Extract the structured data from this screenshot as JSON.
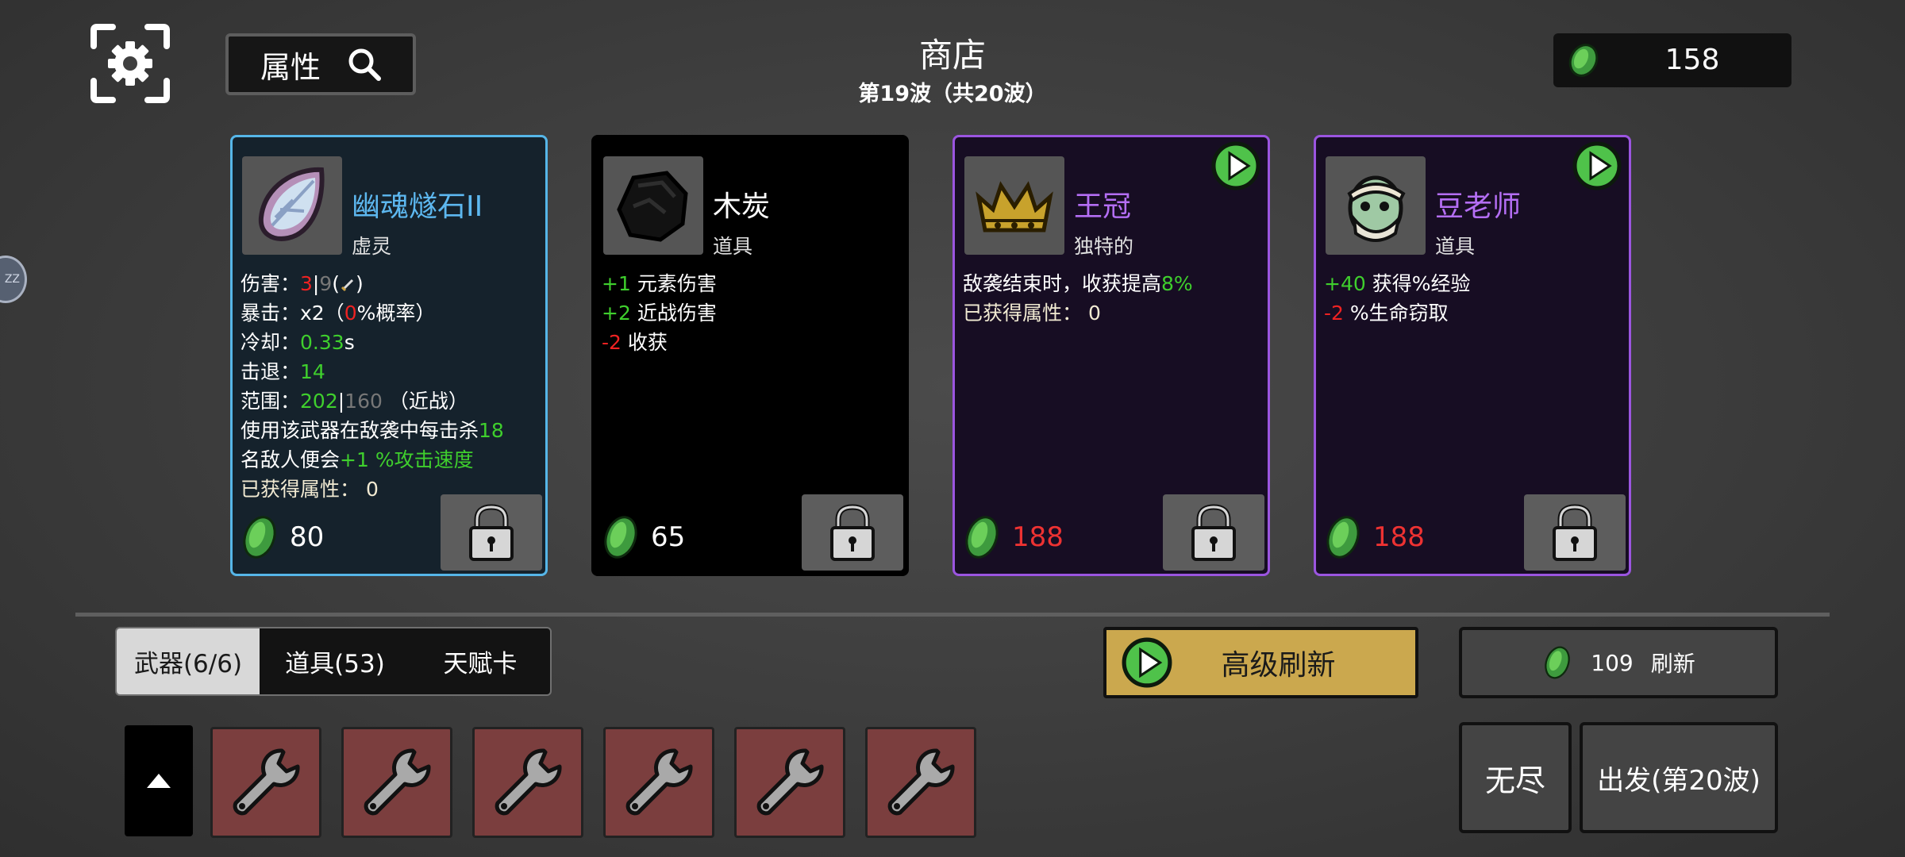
{
  "header": {
    "attributes_label": "属性",
    "title": "商店",
    "wave_subtitle": "第19波（共20波）",
    "money": "158"
  },
  "side_bubble": "ZZ",
  "cards": [
    {
      "name": "幽魂燧石II",
      "type": "虚灵",
      "price": "80",
      "stats": {
        "damage_label": "伤害：",
        "damage_value": "3",
        "damage_base": "9",
        "crit_label": "暴击：",
        "crit_mult": "x2（",
        "crit_chance": "0",
        "crit_suffix": "%概率）",
        "cooldown_label": "冷却：",
        "cooldown_value": "0.33",
        "cooldown_unit": "s",
        "knockback_label": "击退：",
        "knockback_value": "14",
        "range_label": "范围：",
        "range_value": "202",
        "range_base": "160",
        "range_suffix": "（近战）",
        "effect_text_1": "使用该武器在敌袭中每击杀",
        "effect_kills": "18",
        "effect_text_2": "名敌人便会",
        "effect_bonus": "+1 %攻击速度",
        "acquired_label": "已获得属性：",
        "acquired_value": "0"
      }
    },
    {
      "name": "木炭",
      "type": "道具",
      "price": "65",
      "stats": [
        {
          "value": "+1",
          "text": "元素伤害",
          "color": "#3fcf2d"
        },
        {
          "value": "+2",
          "text": "近战伤害",
          "color": "#3fcf2d"
        },
        {
          "value": "-2",
          "text": "收获",
          "color": "#ee2222"
        }
      ]
    },
    {
      "name": "王冠",
      "type": "独特的",
      "price": "188",
      "stats": {
        "line1_text": "敌袭结束时，收获提高",
        "line1_value": "8%",
        "line2_label": "已获得属性：",
        "line2_value": "0"
      }
    },
    {
      "name": "豆老师",
      "type": "道具",
      "price": "188",
      "stats": [
        {
          "value": "+40",
          "text": "获得%经验",
          "color": "#3fcf2d"
        },
        {
          "value": "-2",
          "text": "%生命窃取",
          "color": "#ee2222"
        }
      ]
    }
  ],
  "tabs": [
    "武器(6/6)",
    "道具(53)",
    "天赋卡"
  ],
  "advanced_refresh_label": "高级刷新",
  "refresh": {
    "cost": "109",
    "label": "刷新"
  },
  "weapon_slots": 6,
  "endless_label": "无尽",
  "depart_label": "出发(第20波)",
  "colors": {
    "money_green": "#4caf50",
    "positive": "#3fcf2d",
    "negative": "#ee2222",
    "rare_border": "#56b6e8",
    "epic_border": "#9b55e0",
    "gold_button": "#cba84e",
    "slot_red": "#7b3e3e"
  },
  "icons": [
    "gear-icon",
    "search-icon",
    "coin-icon",
    "lock-icon",
    "play-icon",
    "wrench-icon",
    "arrow-up-icon",
    "sword-icon"
  ]
}
